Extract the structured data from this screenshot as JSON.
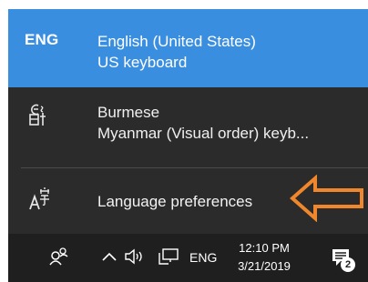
{
  "flyout": {
    "selected_language": {
      "code": "ENG",
      "name": "English (United States)",
      "keyboard": "US keyboard"
    },
    "other_language": {
      "name": "Burmese",
      "keyboard": "Myanmar (Visual order) keyb..."
    },
    "preferences_label": "Language preferences"
  },
  "taskbar": {
    "input_indicator": "ENG",
    "time": "12:10 PM",
    "date": "3/21/2019",
    "notification_count": "2"
  },
  "colors": {
    "flyout_bg": "#2b2b2b",
    "selected_bg": "#3a8ee0",
    "taskbar_bg": "#1f1f1f",
    "arrow_outline": "#f0872c"
  },
  "icons": {
    "burmese": "burmese-script-icon",
    "preferences": "language-preferences-icon",
    "people": "people-icon",
    "chevron": "chevron-up-icon",
    "volume": "volume-icon",
    "network": "network-icon",
    "notifications": "action-center-icon"
  }
}
